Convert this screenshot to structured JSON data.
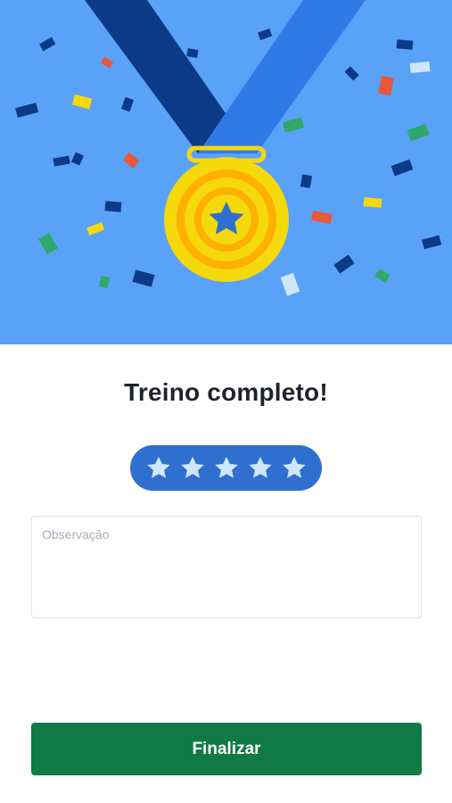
{
  "screen": {
    "title": "Treino completo!"
  },
  "hero": {
    "illustration": "medal-with-confetti",
    "background_color": "#5aa2f8",
    "medal_color": "#f5d90a",
    "ribbon_dark": "#0c3a86",
    "ribbon_light": "#2f7ae6"
  },
  "rating": {
    "value": 5,
    "max": 5,
    "star_icon": "star-icon",
    "pill_color": "#2f6fd0",
    "star_color": "#cfe6fb"
  },
  "observation": {
    "placeholder": "Observação",
    "value": ""
  },
  "actions": {
    "finish_label": "Finalizar",
    "finish_color": "#0f7a45"
  }
}
